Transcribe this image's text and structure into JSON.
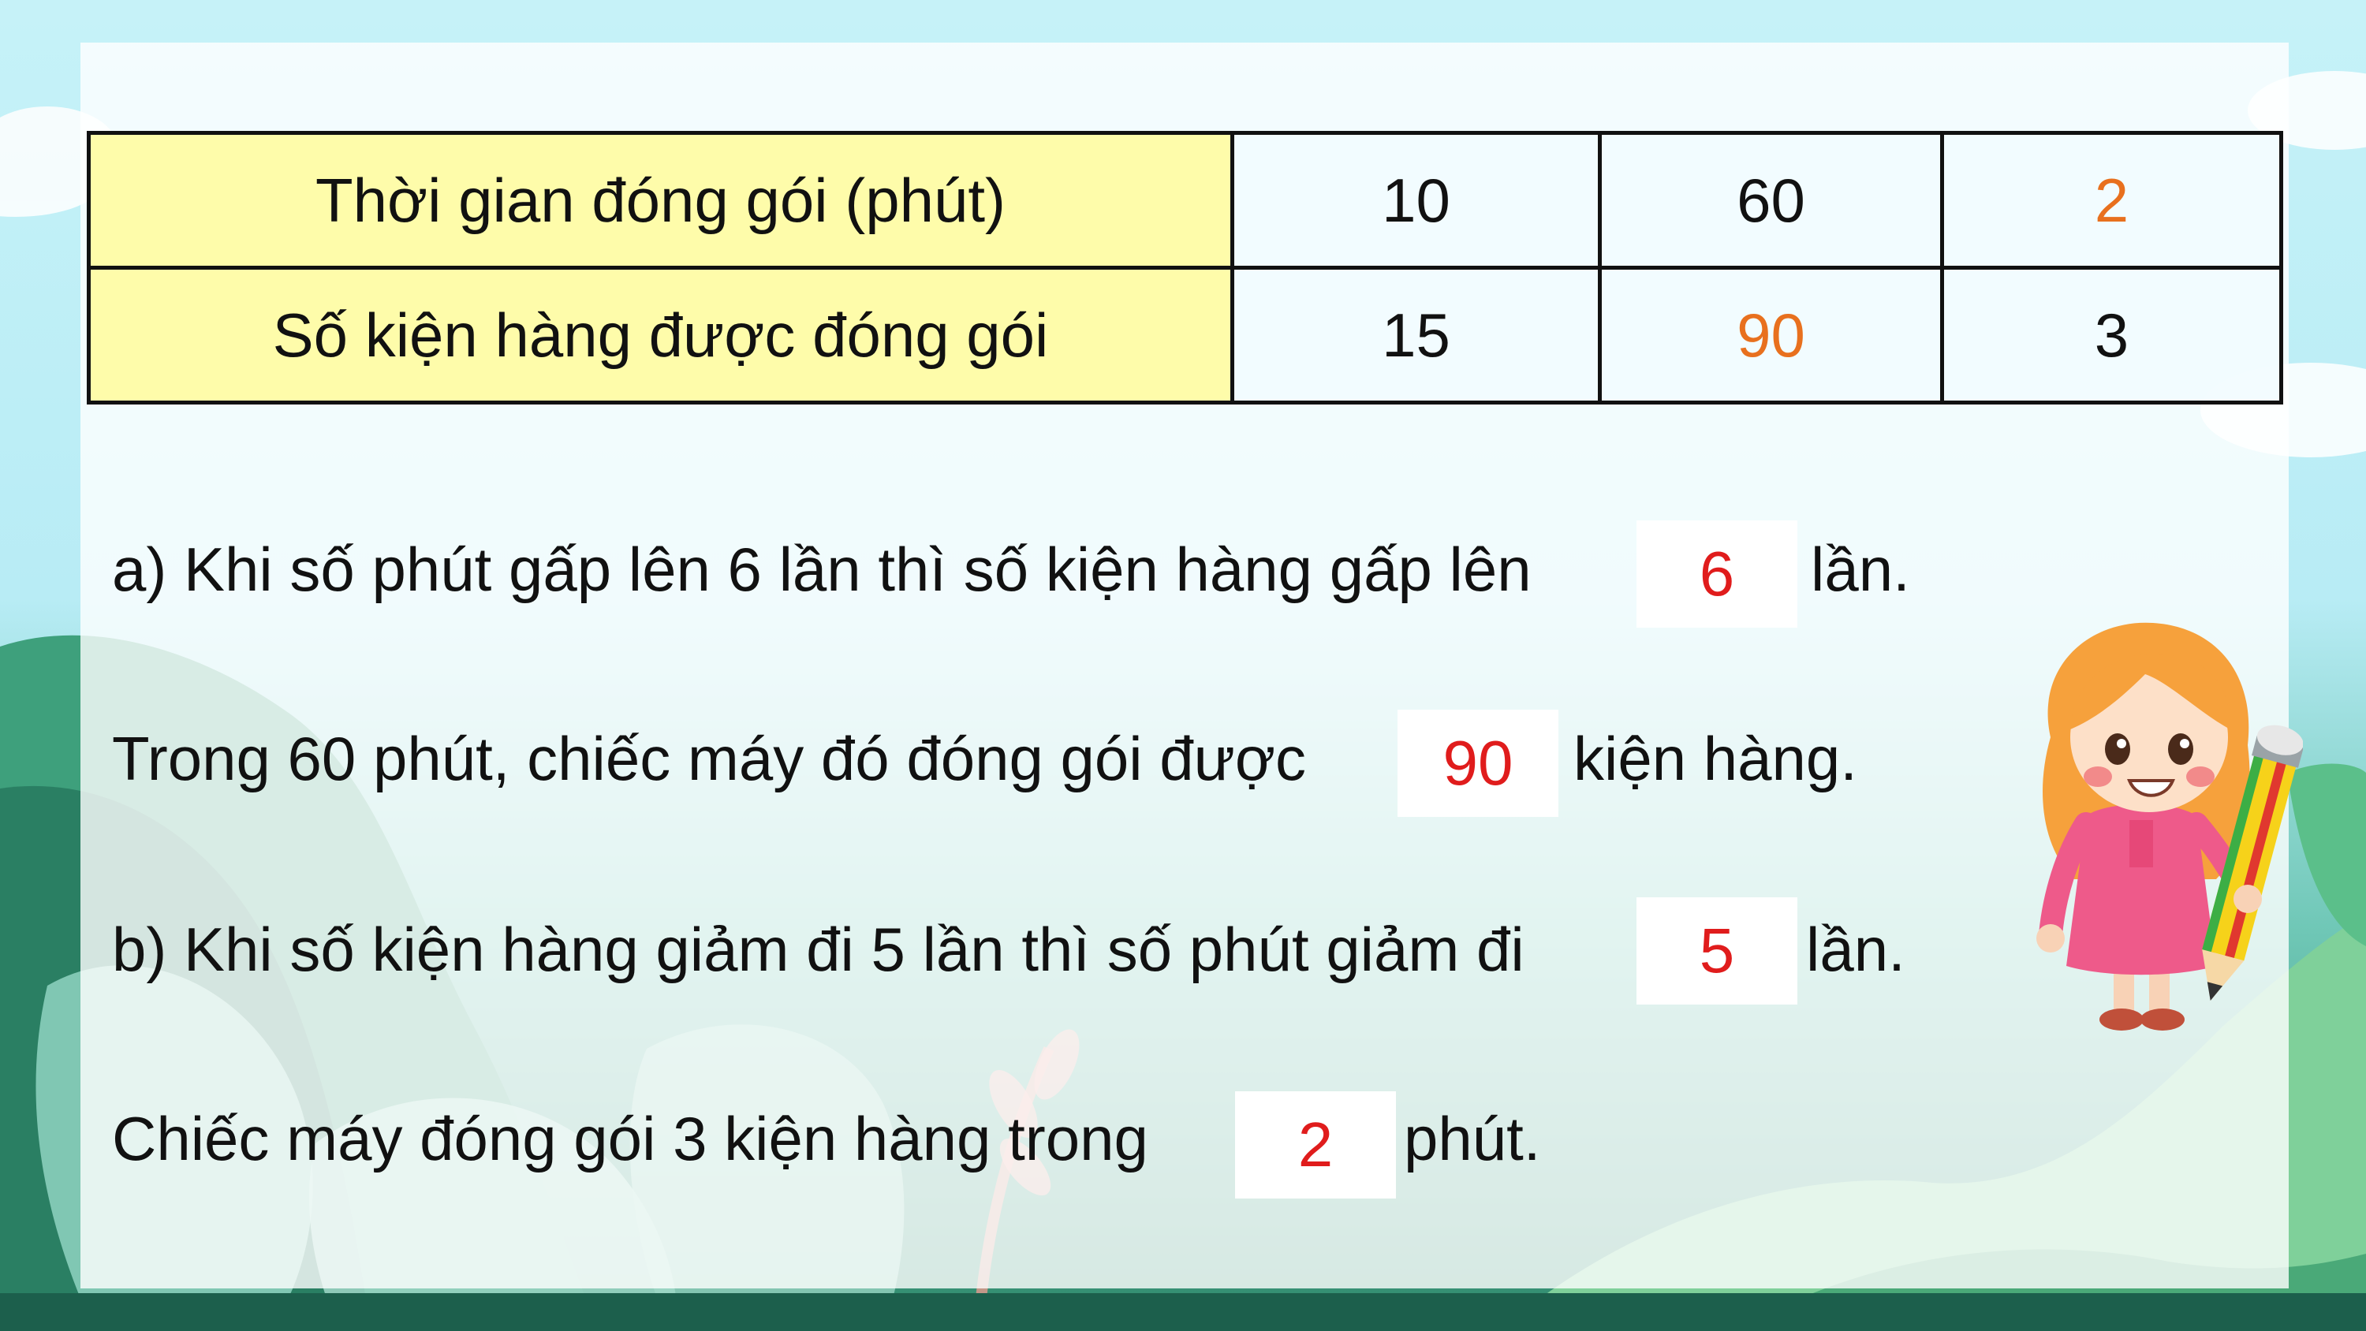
{
  "table": {
    "rows": [
      {
        "header": "Thời gian đóng gói (phút)",
        "cells": [
          "10",
          "60",
          "2"
        ]
      },
      {
        "header": "Số kiện hàng được đóng gói",
        "cells": [
          "15",
          "90",
          "3"
        ]
      }
    ],
    "highlight_cells": [
      "row1.col3",
      "row2.col2"
    ]
  },
  "questions": {
    "a1": {
      "before": "a) Khi số phút gấp lên 6 lần thì số kiện hàng gấp lên",
      "answer": "6",
      "after": "lần."
    },
    "a2": {
      "before": "Trong 60 phút, chiếc máy đó đóng gói được",
      "answer": "90",
      "after": "kiện hàng."
    },
    "b1": {
      "before": "b) Khi số kiện hàng giảm đi 5 lần thì số phút giảm đi",
      "answer": "5",
      "after": "lần."
    },
    "b2": {
      "before": "Chiếc máy đóng gói 3 kiện hàng trong",
      "answer": "2",
      "after": "phút."
    }
  },
  "colors": {
    "header_fill": "#fefcaa",
    "highlight_text": "#e8701e",
    "answer_text": "#e01c1c",
    "background_sky": "#c6f2f8",
    "background_foliage": "#2f8a6c"
  },
  "icons": {
    "illustration": "girl-with-pencil-icon"
  }
}
